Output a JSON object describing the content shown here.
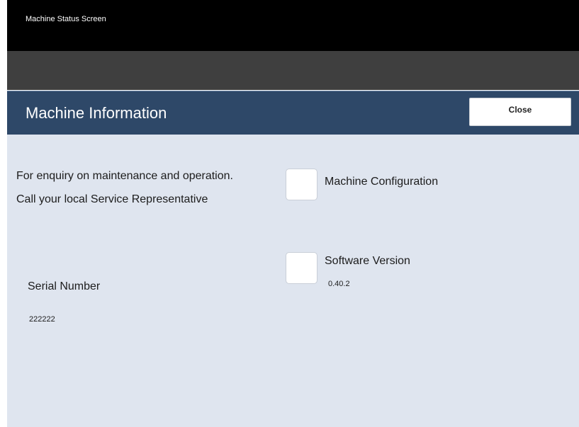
{
  "top_bar": {
    "title": "Machine Status Screen"
  },
  "header": {
    "title": "Machine Information",
    "close_label": "Close"
  },
  "info": {
    "enquiry_text": "For enquiry on maintenance and operation.",
    "call_text": "Call your local Service Representative"
  },
  "options": {
    "machine_configuration_label": "Machine Configuration",
    "software_version_label": "Software Version",
    "software_version_value": "0.40.2"
  },
  "serial": {
    "label": "Serial Number",
    "value": "222222"
  },
  "colors": {
    "top_bar": "#000000",
    "sub_bar": "#3f3f3f",
    "header": "#2e4868",
    "content_background": "#dfe5ef"
  }
}
